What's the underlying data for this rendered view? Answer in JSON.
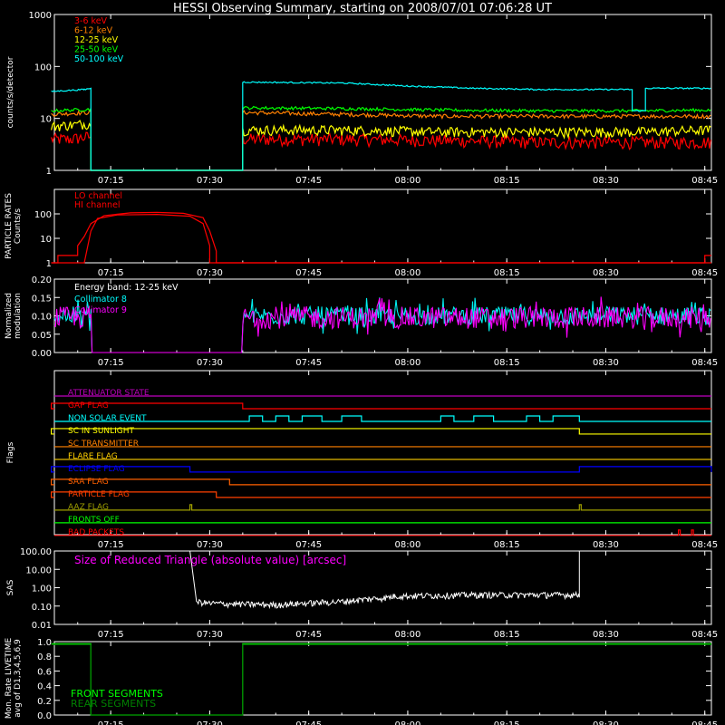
{
  "title": "HESSI Observing Summary, starting on 2008/07/01 07:06:28 UT",
  "time_ticks": [
    "07:15",
    "07:30",
    "07:45",
    "08:00",
    "08:15",
    "08:30",
    "08:45"
  ],
  "colors": {
    "background": "#000000",
    "axes": "#ffffff",
    "red": "#ff0000",
    "orange": "#ff8000",
    "yellow": "#ffff00",
    "green": "#00ff00",
    "cyan": "#00ffff",
    "magenta": "#ff00ff",
    "blue": "#0000ff",
    "purple": "#c000c0",
    "olive": "#a0a000",
    "darkgreen": "#008000"
  },
  "chart_data": [
    {
      "type": "line",
      "panel": "count-rates",
      "ylabel": "counts/s/detector",
      "yscale": "log",
      "ylim": [
        1,
        1000
      ],
      "yticks": [
        "1",
        "10",
        "100",
        "1000"
      ],
      "xlim": [
        "07:06:28",
        "08:46"
      ],
      "legend_placement": "top-left",
      "series": [
        {
          "name": "3-6 keV",
          "color": "#ff0000",
          "points": [
            [
              "07:06",
              4
            ],
            [
              "07:09",
              4
            ],
            [
              "07:12",
              4.5
            ],
            [
              "07:12",
              1
            ],
            [
              "07:35",
              1
            ],
            [
              "07:35",
              4
            ],
            [
              "07:50",
              4
            ],
            [
              "08:05",
              3.8
            ],
            [
              "08:20",
              3.5
            ],
            [
              "08:35",
              3.5
            ],
            [
              "08:46",
              3.5
            ]
          ]
        },
        {
          "name": "6-12 keV",
          "color": "#ff8000",
          "points": [
            [
              "07:06",
              12
            ],
            [
              "07:12",
              13
            ],
            [
              "07:12",
              1
            ],
            [
              "07:35",
              1
            ],
            [
              "07:35",
              13
            ],
            [
              "07:50",
              12
            ],
            [
              "08:05",
              11
            ],
            [
              "08:20",
              11
            ],
            [
              "08:35",
              11
            ],
            [
              "08:46",
              11
            ]
          ]
        },
        {
          "name": "12-25 keV",
          "color": "#ffff00",
          "points": [
            [
              "07:06",
              7
            ],
            [
              "07:12",
              8
            ],
            [
              "07:12",
              1
            ],
            [
              "07:35",
              1
            ],
            [
              "07:35",
              6
            ],
            [
              "07:50",
              6
            ],
            [
              "08:05",
              5.5
            ],
            [
              "08:20",
              5.5
            ],
            [
              "08:35",
              5.5
            ],
            [
              "08:46",
              6
            ]
          ]
        },
        {
          "name": "25-50 keV",
          "color": "#00ff00",
          "points": [
            [
              "07:06",
              14
            ],
            [
              "07:12",
              15
            ],
            [
              "07:12",
              1
            ],
            [
              "07:35",
              1
            ],
            [
              "07:35",
              16
            ],
            [
              "07:50",
              15.5
            ],
            [
              "08:05",
              14.5
            ],
            [
              "08:20",
              14
            ],
            [
              "08:35",
              14
            ],
            [
              "08:46",
              14.5
            ]
          ]
        },
        {
          "name": "50-100 keV",
          "color": "#00ffff",
          "points": [
            [
              "07:06",
              33
            ],
            [
              "07:11",
              36
            ],
            [
              "07:12",
              38
            ],
            [
              "07:12",
              1
            ],
            [
              "07:35",
              1
            ],
            [
              "07:35",
              50
            ],
            [
              "07:50",
              48
            ],
            [
              "08:00",
              42
            ],
            [
              "08:10",
              38
            ],
            [
              "08:20",
              36
            ],
            [
              "08:34",
              36
            ],
            [
              "08:34",
              14
            ],
            [
              "08:36",
              14
            ],
            [
              "08:36",
              38
            ],
            [
              "08:46",
              38
            ]
          ]
        }
      ]
    },
    {
      "type": "line",
      "panel": "particle-rates",
      "ylabel": "PARTICLE RATES Counts/s",
      "yscale": "log",
      "ylim": [
        1,
        1000
      ],
      "yticks": [
        "1",
        "10",
        "100"
      ],
      "series": [
        {
          "name": "LO channel",
          "color": "#ff0000",
          "points": [
            [
              "07:06",
              1
            ],
            [
              "07:07",
              1
            ],
            [
              "07:07",
              2
            ],
            [
              "07:10",
              2
            ],
            [
              "07:10",
              5
            ],
            [
              "07:11",
              12
            ],
            [
              "07:12",
              40
            ],
            [
              "07:14",
              85
            ],
            [
              "07:18",
              110
            ],
            [
              "07:22",
              115
            ],
            [
              "07:26",
              105
            ],
            [
              "07:29",
              70
            ],
            [
              "07:30",
              20
            ],
            [
              "07:31",
              3
            ],
            [
              "07:31",
              1
            ],
            [
              "08:45",
              1
            ],
            [
              "08:45",
              2
            ],
            [
              "08:46",
              2
            ]
          ]
        },
        {
          "name": "HI channel",
          "color": "#ff0000",
          "points": [
            [
              "07:06",
              1
            ],
            [
              "07:11",
              1
            ],
            [
              "07:12",
              20
            ],
            [
              "07:13",
              65
            ],
            [
              "07:16",
              90
            ],
            [
              "07:22",
              95
            ],
            [
              "07:27",
              80
            ],
            [
              "07:29",
              40
            ],
            [
              "07:30",
              5
            ],
            [
              "07:30",
              1
            ],
            [
              "08:46",
              1
            ]
          ]
        }
      ]
    },
    {
      "type": "line",
      "panel": "normalized-modulation",
      "ylabel": "Normalized modulation",
      "ylim": [
        0,
        0.2
      ],
      "yticks": [
        "0.00",
        "0.05",
        "0.10",
        "0.15",
        "0.20"
      ],
      "annotation": "Energy band: 12-25 keV",
      "series": [
        {
          "name": "Collimator 8",
          "color": "#00ffff",
          "mean": 0.1,
          "spread": 0.025,
          "gap": [
            "07:12",
            "07:35"
          ]
        },
        {
          "name": "Collimator 9",
          "color": "#ff00ff",
          "mean": 0.095,
          "spread": 0.03,
          "gap": [
            "07:12",
            "07:35"
          ]
        }
      ]
    },
    {
      "type": "line",
      "panel": "flags",
      "ylabel": "Flags",
      "flags": [
        {
          "name": "ATTENUATOR STATE",
          "color": "#c000c0",
          "high": []
        },
        {
          "name": "GAP FLAG",
          "color": "#ff0000",
          "high": [
            [
              "07:06",
              "07:35"
            ]
          ]
        },
        {
          "name": "NON SOLAR EVENT",
          "color": "#00ffff",
          "high": [
            [
              "07:36",
              "07:38"
            ],
            [
              "07:40",
              "07:42"
            ],
            [
              "07:44",
              "07:47"
            ],
            [
              "07:50",
              "07:53"
            ],
            [
              "08:05",
              "08:07"
            ],
            [
              "08:10",
              "08:13"
            ],
            [
              "08:18",
              "08:20"
            ],
            [
              "08:22",
              "08:26"
            ]
          ]
        },
        {
          "name": "SC IN SUNLIGHT",
          "color": "#ffff00",
          "high": [
            [
              "07:06",
              "08:26"
            ]
          ]
        },
        {
          "name": "SC TRANSMITTER",
          "color": "#ff8000",
          "high": []
        },
        {
          "name": "FLARE FLAG",
          "color": "#ffd000",
          "high": []
        },
        {
          "name": "ECLIPSE FLAG",
          "color": "#0000ff",
          "high": [
            [
              "07:06",
              "07:27"
            ],
            [
              "08:26",
              "08:46"
            ]
          ]
        },
        {
          "name": "SAA FLAG",
          "color": "#ff6000",
          "high": [
            [
              "07:06",
              "07:33"
            ]
          ]
        },
        {
          "name": "PARTICLE FLAG",
          "color": "#ff4000",
          "high": [
            [
              "07:06",
              "07:31"
            ]
          ]
        },
        {
          "name": "AAZ FLAG",
          "color": "#a0a000",
          "high": [
            [
              "07:27",
              "07:27"
            ],
            [
              "08:26",
              "08:26"
            ]
          ]
        },
        {
          "name": "FRONTS OFF",
          "color": "#00ff00",
          "high": []
        },
        {
          "name": "BAD PACKETS",
          "color": "#ff0000",
          "high": [
            [
              "08:41",
              "08:41"
            ],
            [
              "08:43",
              "08:43"
            ]
          ]
        }
      ]
    },
    {
      "type": "line",
      "panel": "sas",
      "ylabel": "SAS",
      "yscale": "log",
      "ylim": [
        0.01,
        100
      ],
      "yticks": [
        "0.01",
        "0.10",
        "1.00",
        "10.00",
        "100.00"
      ],
      "annotation": "Size of Reduced Triangle (absolute value) [arcsec]",
      "series": [
        {
          "name": "Size of Reduced Triangle",
          "color": "#ffffff",
          "points": [
            [
              "07:27",
              100
            ],
            [
              "07:28",
              0.15
            ],
            [
              "07:30",
              0.12
            ],
            [
              "07:40",
              0.1
            ],
            [
              "07:50",
              0.15
            ],
            [
              "07:57",
              0.25
            ],
            [
              "07:58",
              0.3
            ],
            [
              "08:10",
              0.35
            ],
            [
              "08:20",
              0.35
            ],
            [
              "08:26",
              0.35
            ],
            [
              "08:26",
              100
            ]
          ]
        }
      ]
    },
    {
      "type": "line",
      "panel": "livetime",
      "ylabel": "Mon. Rate LIVETIME avg of D1,3,4,5,6,9",
      "ylim": [
        0,
        1
      ],
      "yticks": [
        "0.0",
        "0.2",
        "0.4",
        "0.6",
        "0.8",
        "1.0"
      ],
      "series": [
        {
          "name": "FRONT SEGMENTS",
          "color": "#00ff00",
          "points": [
            [
              "07:06",
              0.97
            ],
            [
              "07:12",
              0.97
            ],
            [
              "07:12",
              0
            ],
            [
              "07:35",
              0
            ],
            [
              "07:35",
              0.97
            ],
            [
              "08:46",
              0.97
            ]
          ]
        },
        {
          "name": "REAR SEGMENTS",
          "color": "#008000",
          "points": [
            [
              "07:06",
              0.96
            ],
            [
              "07:12",
              0.96
            ],
            [
              "07:12",
              0
            ],
            [
              "07:35",
              0
            ],
            [
              "07:35",
              0.96
            ],
            [
              "08:46",
              0.96
            ]
          ]
        }
      ]
    }
  ]
}
